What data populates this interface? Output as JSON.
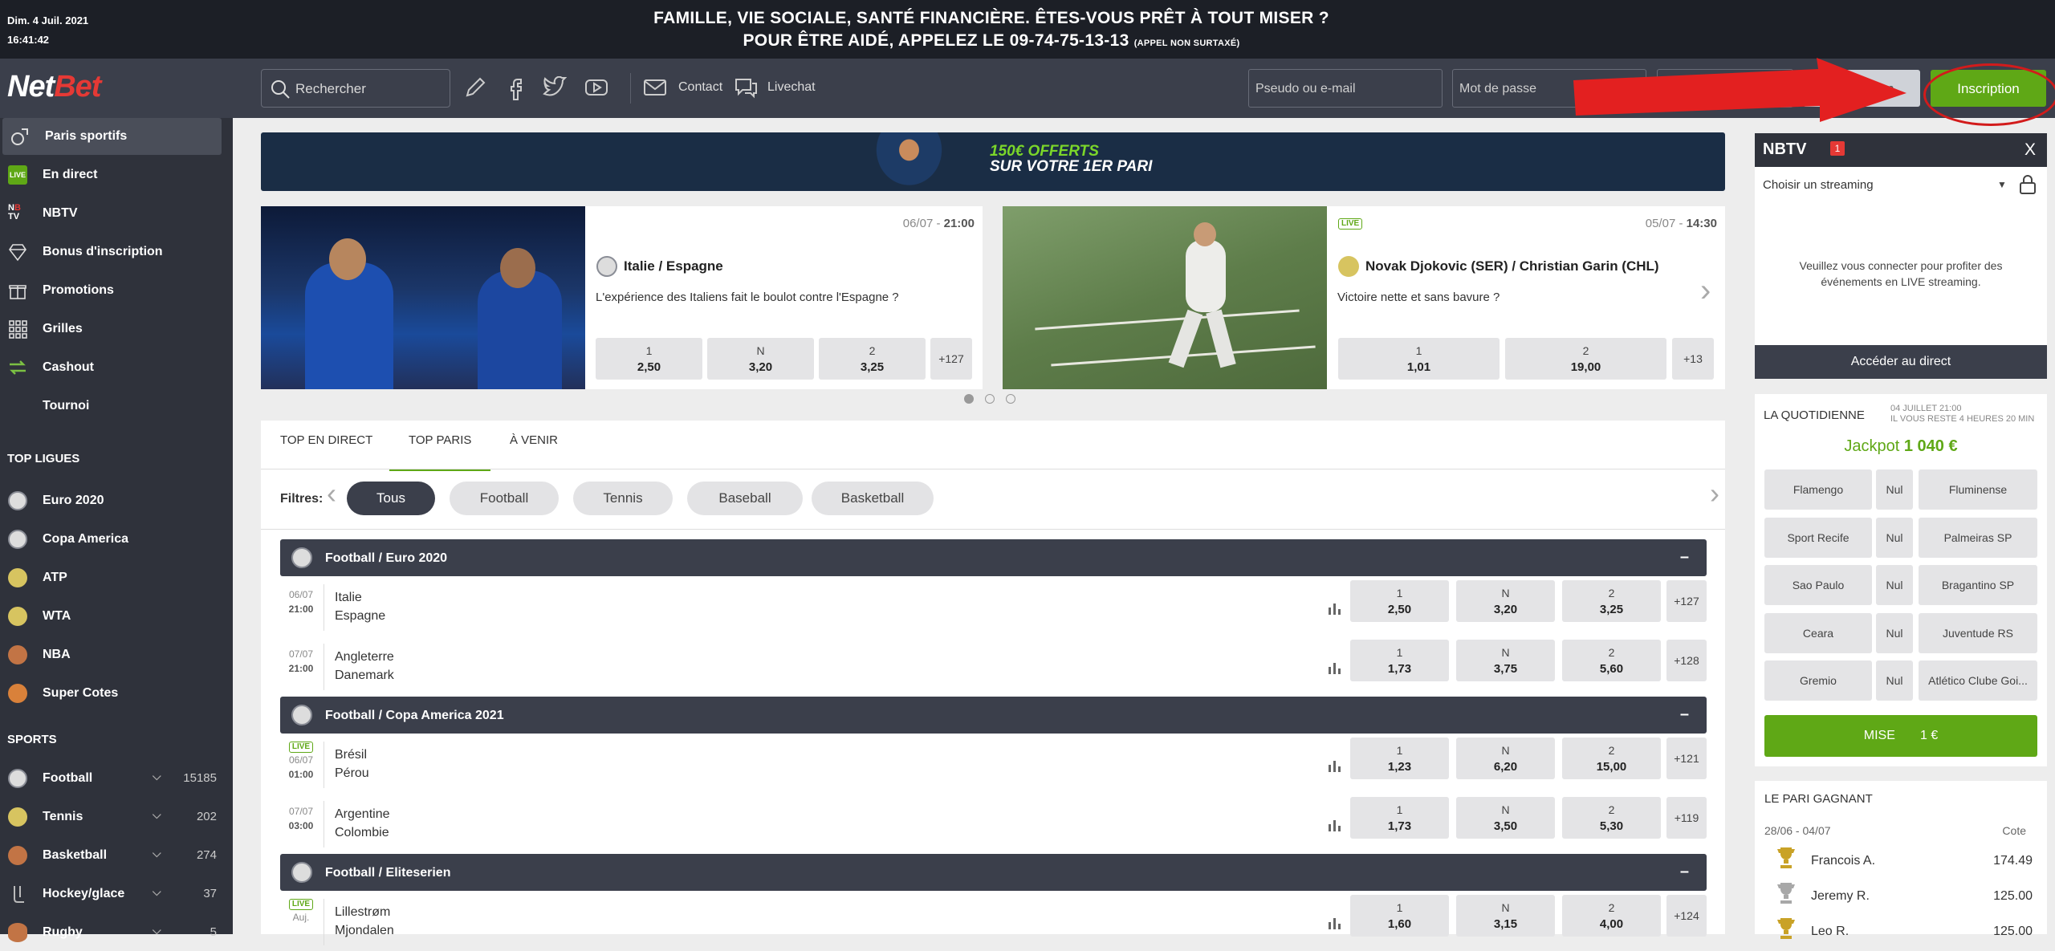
{
  "topbar": {
    "date": "Dim. 4 Juil. 2021",
    "time": "16:41:42",
    "line1": "FAMILLE, VIE SOCIALE, SANTÉ FINANCIÈRE. ÊTES-VOUS PRÊT À TOUT MISER ?",
    "line2": "POUR ÊTRE AIDÉ, APPELEZ LE 09-74-75-13-13",
    "line2_small": "(APPEL NON SURTAXÉ)"
  },
  "header": {
    "logo_a": "Net",
    "logo_b": "Bet",
    "search_placeholder": "Rechercher",
    "contact": "Contact",
    "livechat": "Livechat",
    "login_placeholder": "Pseudo ou e-mail",
    "password_placeholder": "Mot de passe",
    "connexion": "Connexion",
    "inscription": "Inscription",
    "accent": "#5fa816",
    "annotation_color": "#d21b1b"
  },
  "sidebar": {
    "items": [
      {
        "label": "Paris sportifs",
        "icon": "sports-icon"
      },
      {
        "label": "En direct",
        "icon": "live-icon"
      },
      {
        "label": "NBTV",
        "icon": "nbtv-icon"
      },
      {
        "label": "Bonus d'inscription",
        "icon": "diamond-icon"
      },
      {
        "label": "Promotions",
        "icon": "gift-icon"
      },
      {
        "label": "Grilles",
        "icon": "grid-icon"
      },
      {
        "label": "Cashout",
        "icon": "cashout-icon"
      },
      {
        "label": "Tournoi",
        "icon": ""
      }
    ],
    "top_ligues_title": "TOP LIGUES",
    "ligues": [
      "Euro 2020",
      "Copa America",
      "ATP",
      "WTA",
      "NBA",
      "Super Cotes"
    ],
    "sports_title": "SPORTS",
    "sports": [
      {
        "label": "Football",
        "count": "15185"
      },
      {
        "label": "Tennis",
        "count": "202"
      },
      {
        "label": "Basketball",
        "count": "274"
      },
      {
        "label": "Hockey/glace",
        "count": "37"
      },
      {
        "label": "Rugby",
        "count": "5"
      }
    ]
  },
  "promo": {
    "line1": "150€ OFFERTS",
    "line2": "SUR VOTRE 1ER PARI"
  },
  "cards": [
    {
      "date": "06/07 - ",
      "time": "21:00",
      "title": "Italie / Espagne",
      "desc": "L'expérience des Italiens fait le boulot contre l'Espagne ?",
      "odds": [
        {
          "l": "1",
          "v": "2,50"
        },
        {
          "l": "N",
          "v": "3,20"
        },
        {
          "l": "2",
          "v": "3,25"
        }
      ],
      "more": "+127"
    },
    {
      "live": "LIVE",
      "date": "05/07 - ",
      "time": "14:30",
      "title": "Novak Djokovic (SER) / Christian Garin (CHL)",
      "desc": "Victoire nette et sans bavure ?",
      "odds": [
        {
          "l": "1",
          "v": "1,01"
        },
        {
          "l": "2",
          "v": "19,00"
        }
      ],
      "more": "+13"
    }
  ],
  "tabs": [
    "TOP EN DIRECT",
    "TOP PARIS",
    "À VENIR"
  ],
  "filters": {
    "label": "Filtres:",
    "items": [
      "Tous",
      "Football",
      "Tennis",
      "Baseball",
      "Basketball"
    ]
  },
  "groups": [
    {
      "title": "Football / Euro 2020",
      "rows": [
        {
          "d": "06/07",
          "t": "21:00",
          "h": "Italie",
          "a": "Espagne",
          "odds": [
            "2,50",
            "3,20",
            "3,25"
          ],
          "more": "+127"
        },
        {
          "d": "07/07",
          "t": "21:00",
          "h": "Angleterre",
          "a": "Danemark",
          "odds": [
            "1,73",
            "3,75",
            "5,60"
          ],
          "more": "+128"
        }
      ]
    },
    {
      "title": "Football / Copa America 2021",
      "rows": [
        {
          "live": "LIVE",
          "d": "06/07",
          "t": "01:00",
          "h": "Brésil",
          "a": "Pérou",
          "odds": [
            "1,23",
            "6,20",
            "15,00"
          ],
          "more": "+121"
        },
        {
          "d": "07/07",
          "t": "03:00",
          "h": "Argentine",
          "a": "Colombie",
          "odds": [
            "1,73",
            "3,50",
            "5,30"
          ],
          "more": "+119"
        }
      ]
    },
    {
      "title": "Football / Eliteserien",
      "rows": [
        {
          "live": "LIVE",
          "d": "Auj.",
          "t": "",
          "h": "Lillestrøm",
          "a": "Mjondalen",
          "odds": [
            "1,60",
            "3,15",
            "4,00"
          ],
          "more": "+124"
        }
      ]
    }
  ],
  "odd_labels": [
    "1",
    "N",
    "2"
  ],
  "minus": "–",
  "tv": {
    "logo": "NBTV",
    "badge": "1",
    "close": "X",
    "select": "Choisir un streaming",
    "info": "Veuillez vous connecter pour profiter des événements en LIVE streaming.",
    "go": "Accéder au direct"
  },
  "quot": {
    "title": "LA QUOTIDIENNE",
    "sub1": "04 JUILLET 21:00",
    "sub2": "IL VOUS RESTE 4 HEURES 20 MIN",
    "jackpot_label": "Jackpot",
    "jackpot_value": "1 040 €",
    "matches": [
      [
        "Flamengo",
        "Nul",
        "Fluminense"
      ],
      [
        "Sport Recife",
        "Nul",
        "Palmeiras SP"
      ],
      [
        "Sao Paulo",
        "Nul",
        "Bragantino SP"
      ],
      [
        "Ceara",
        "Nul",
        "Juventude RS"
      ],
      [
        "Gremio",
        "Nul",
        "Atlético Clube Goi..."
      ]
    ],
    "mise": "MISE",
    "mise_value": "1 €"
  },
  "pari": {
    "title": "LE PARI GAGNANT",
    "period": "28/06 - 04/07",
    "cote": "Cote",
    "winners": [
      {
        "n": "Francois A.",
        "v": "174.49"
      },
      {
        "n": "Jeremy R.",
        "v": "125.00"
      },
      {
        "n": "Leo R.",
        "v": "125.00"
      }
    ]
  }
}
